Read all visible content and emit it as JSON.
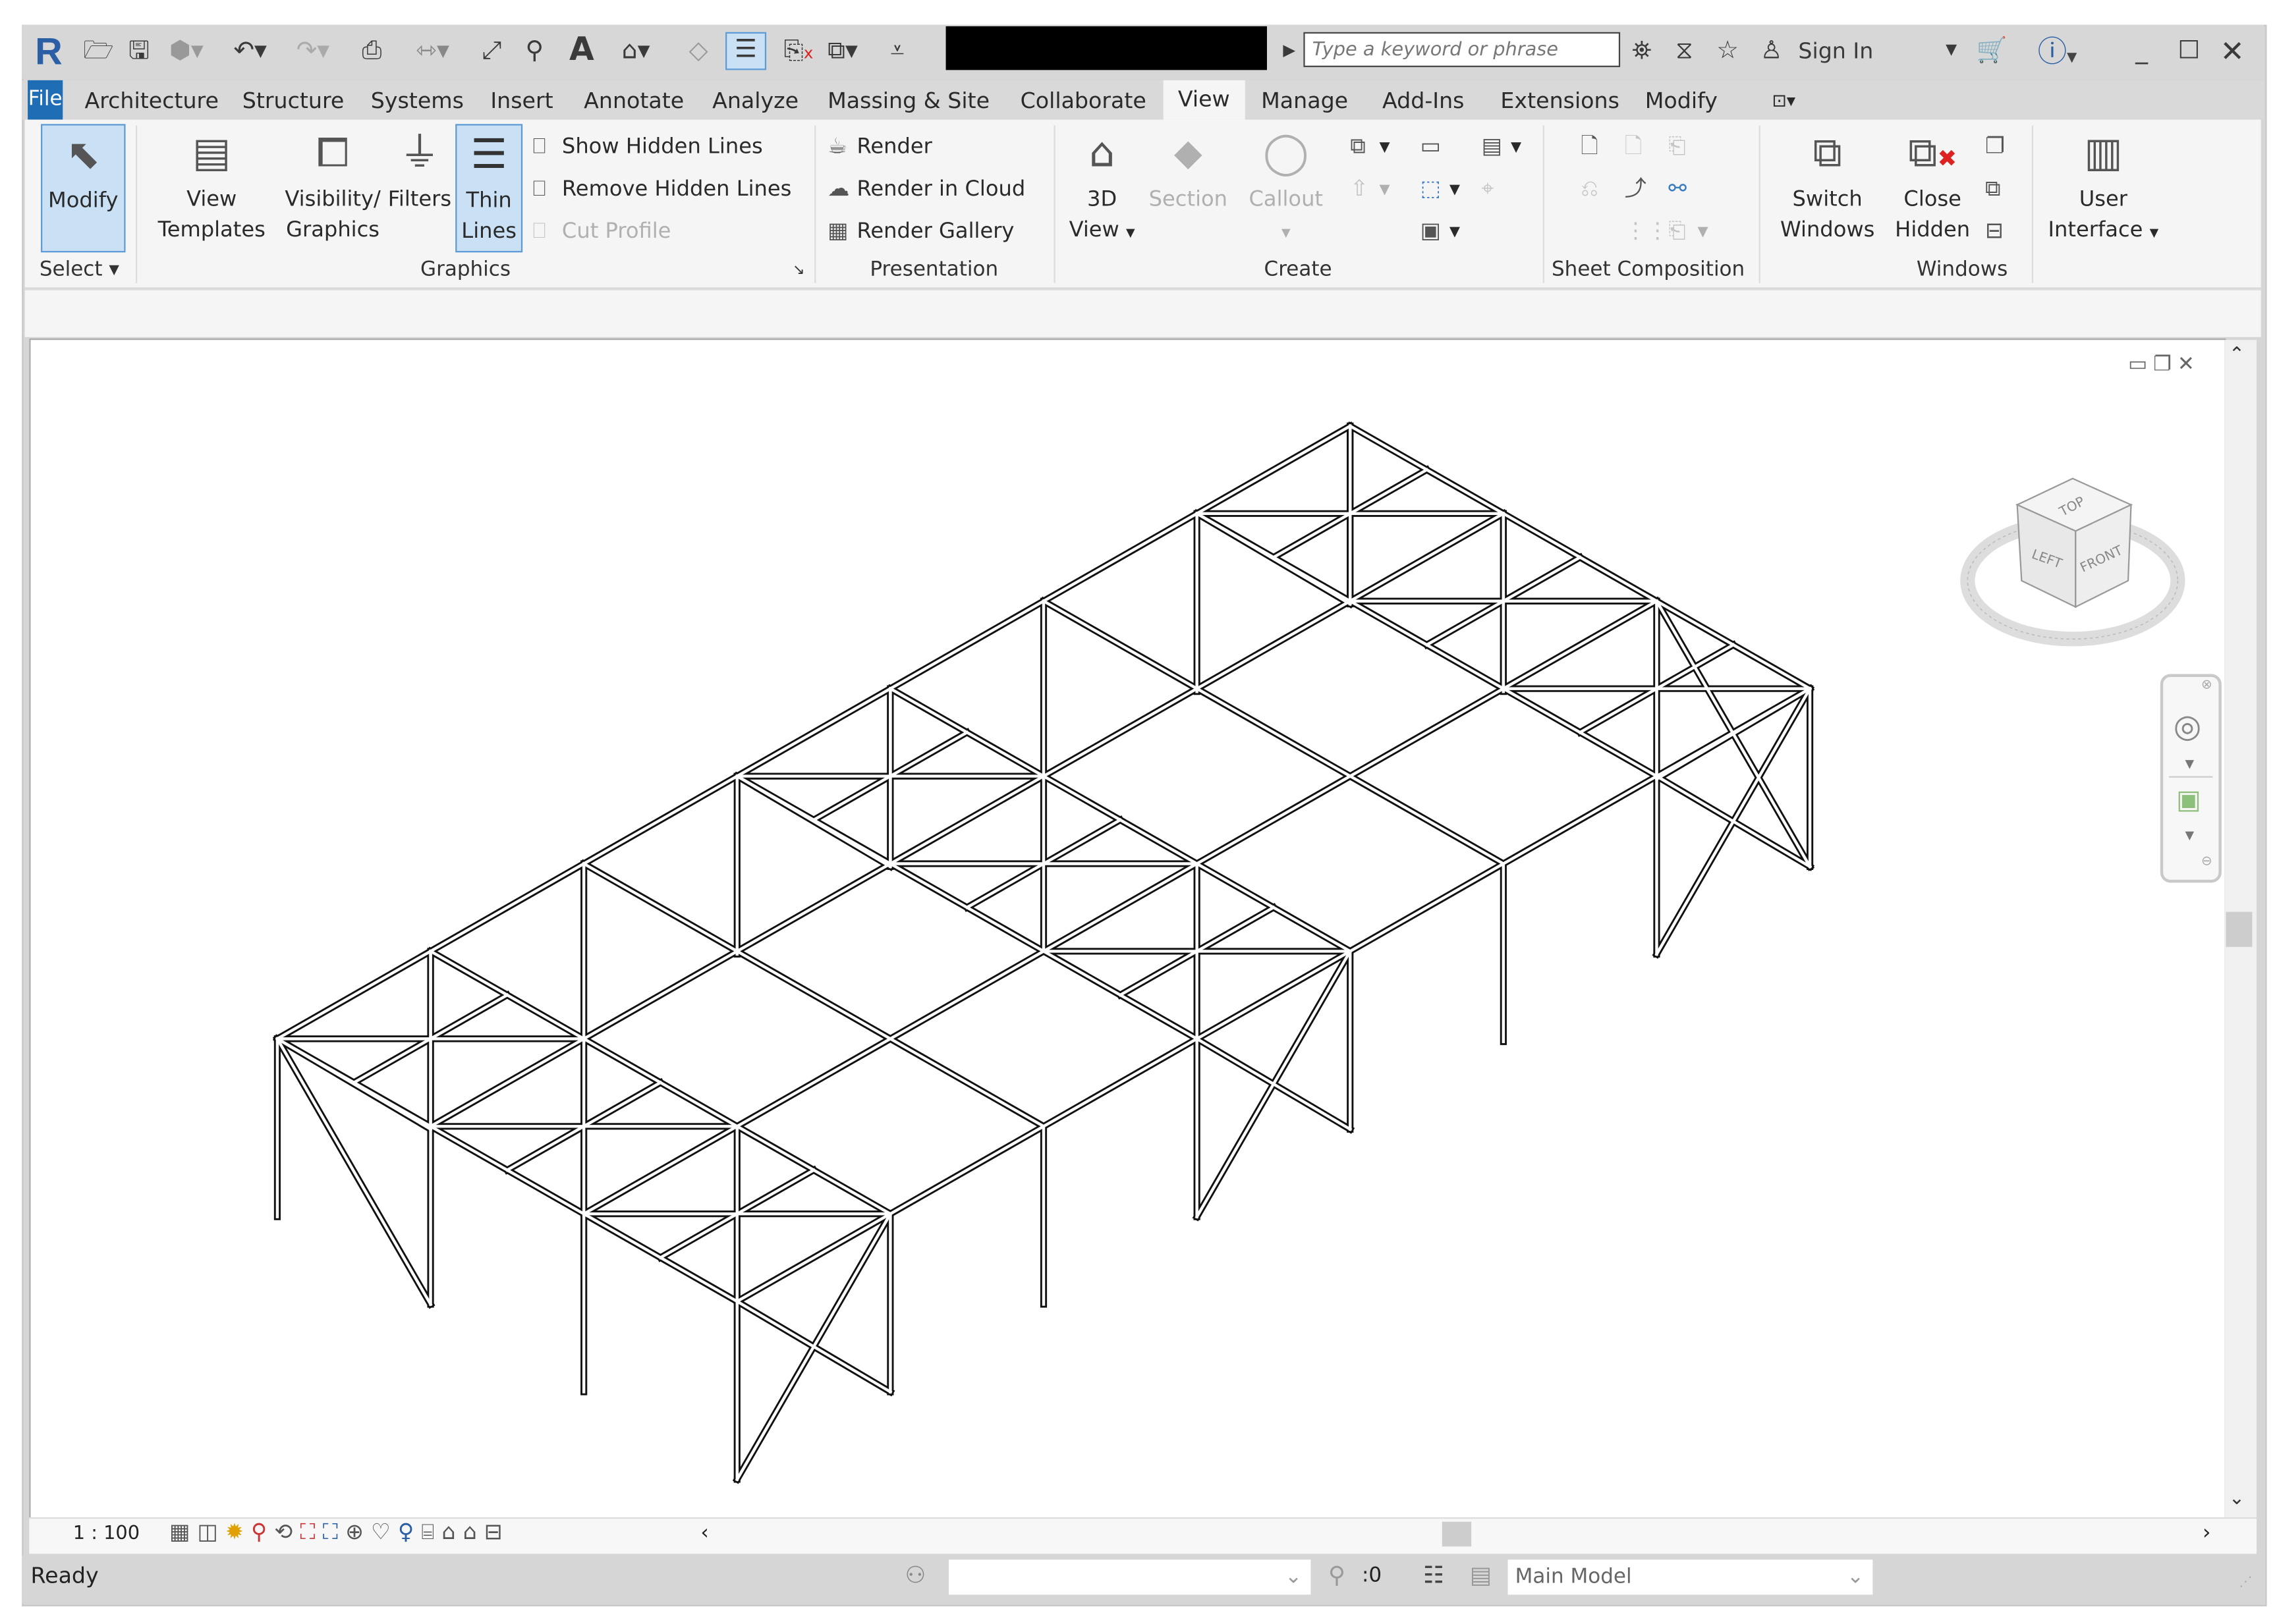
{
  "title_bar": {
    "logo": "R",
    "quick_access_icons": [
      "open-icon",
      "save-icon",
      "sync-icon",
      "undo-icon",
      "redo-icon",
      "print-icon",
      "measure-icon",
      "dimension-icon",
      "tag-icon",
      "text-icon",
      "3d-view-icon",
      "section-icon",
      "thin-lines-icon",
      "close-hidden-icon",
      "switch-windows-icon",
      "customize-icon"
    ],
    "search_placeholder": "Type a keyword or phrase",
    "sign_in": "Sign In"
  },
  "tabs": [
    "File",
    "Architecture",
    "Structure",
    "Systems",
    "Insert",
    "Annotate",
    "Analyze",
    "Massing & Site",
    "Collaborate",
    "View",
    "Manage",
    "Add-Ins",
    "Extensions",
    "Modify"
  ],
  "active_tab": "View",
  "ribbon": {
    "select": {
      "button": "Modify",
      "panel": "Select"
    },
    "graphics": {
      "panel": "Graphics",
      "view_templates": [
        "View",
        "Templates"
      ],
      "visibility": [
        "Visibility/",
        "Graphics"
      ],
      "filters": "Filters",
      "thin_lines": [
        "Thin",
        "Lines"
      ],
      "show_hidden": "Show  Hidden Lines",
      "remove_hidden": "Remove  Hidden Lines",
      "cut_profile": "Cut  Profile"
    },
    "presentation": {
      "panel": "Presentation",
      "render": "Render",
      "render_cloud": "Render  in Cloud",
      "render_gallery": "Render  Gallery"
    },
    "create": {
      "panel": "Create",
      "view3d": [
        "3D",
        "View"
      ],
      "section": "Section",
      "callout": "Callout"
    },
    "sheet": {
      "panel": "Sheet Composition"
    },
    "windows": {
      "panel": "Windows",
      "switch": [
        "Switch",
        "Windows"
      ],
      "close_hidden": [
        "Close",
        "Hidden"
      ]
    },
    "ui": {
      "label": [
        "User",
        "Interface"
      ]
    }
  },
  "viewcube": {
    "top": "TOP",
    "left": "LEFT",
    "front": "FRONT"
  },
  "view_control": {
    "scale": "1 : 100"
  },
  "status": {
    "text": "Ready",
    "worksets_value": "",
    "editable_count": ":0",
    "design_option": "Main Model"
  }
}
